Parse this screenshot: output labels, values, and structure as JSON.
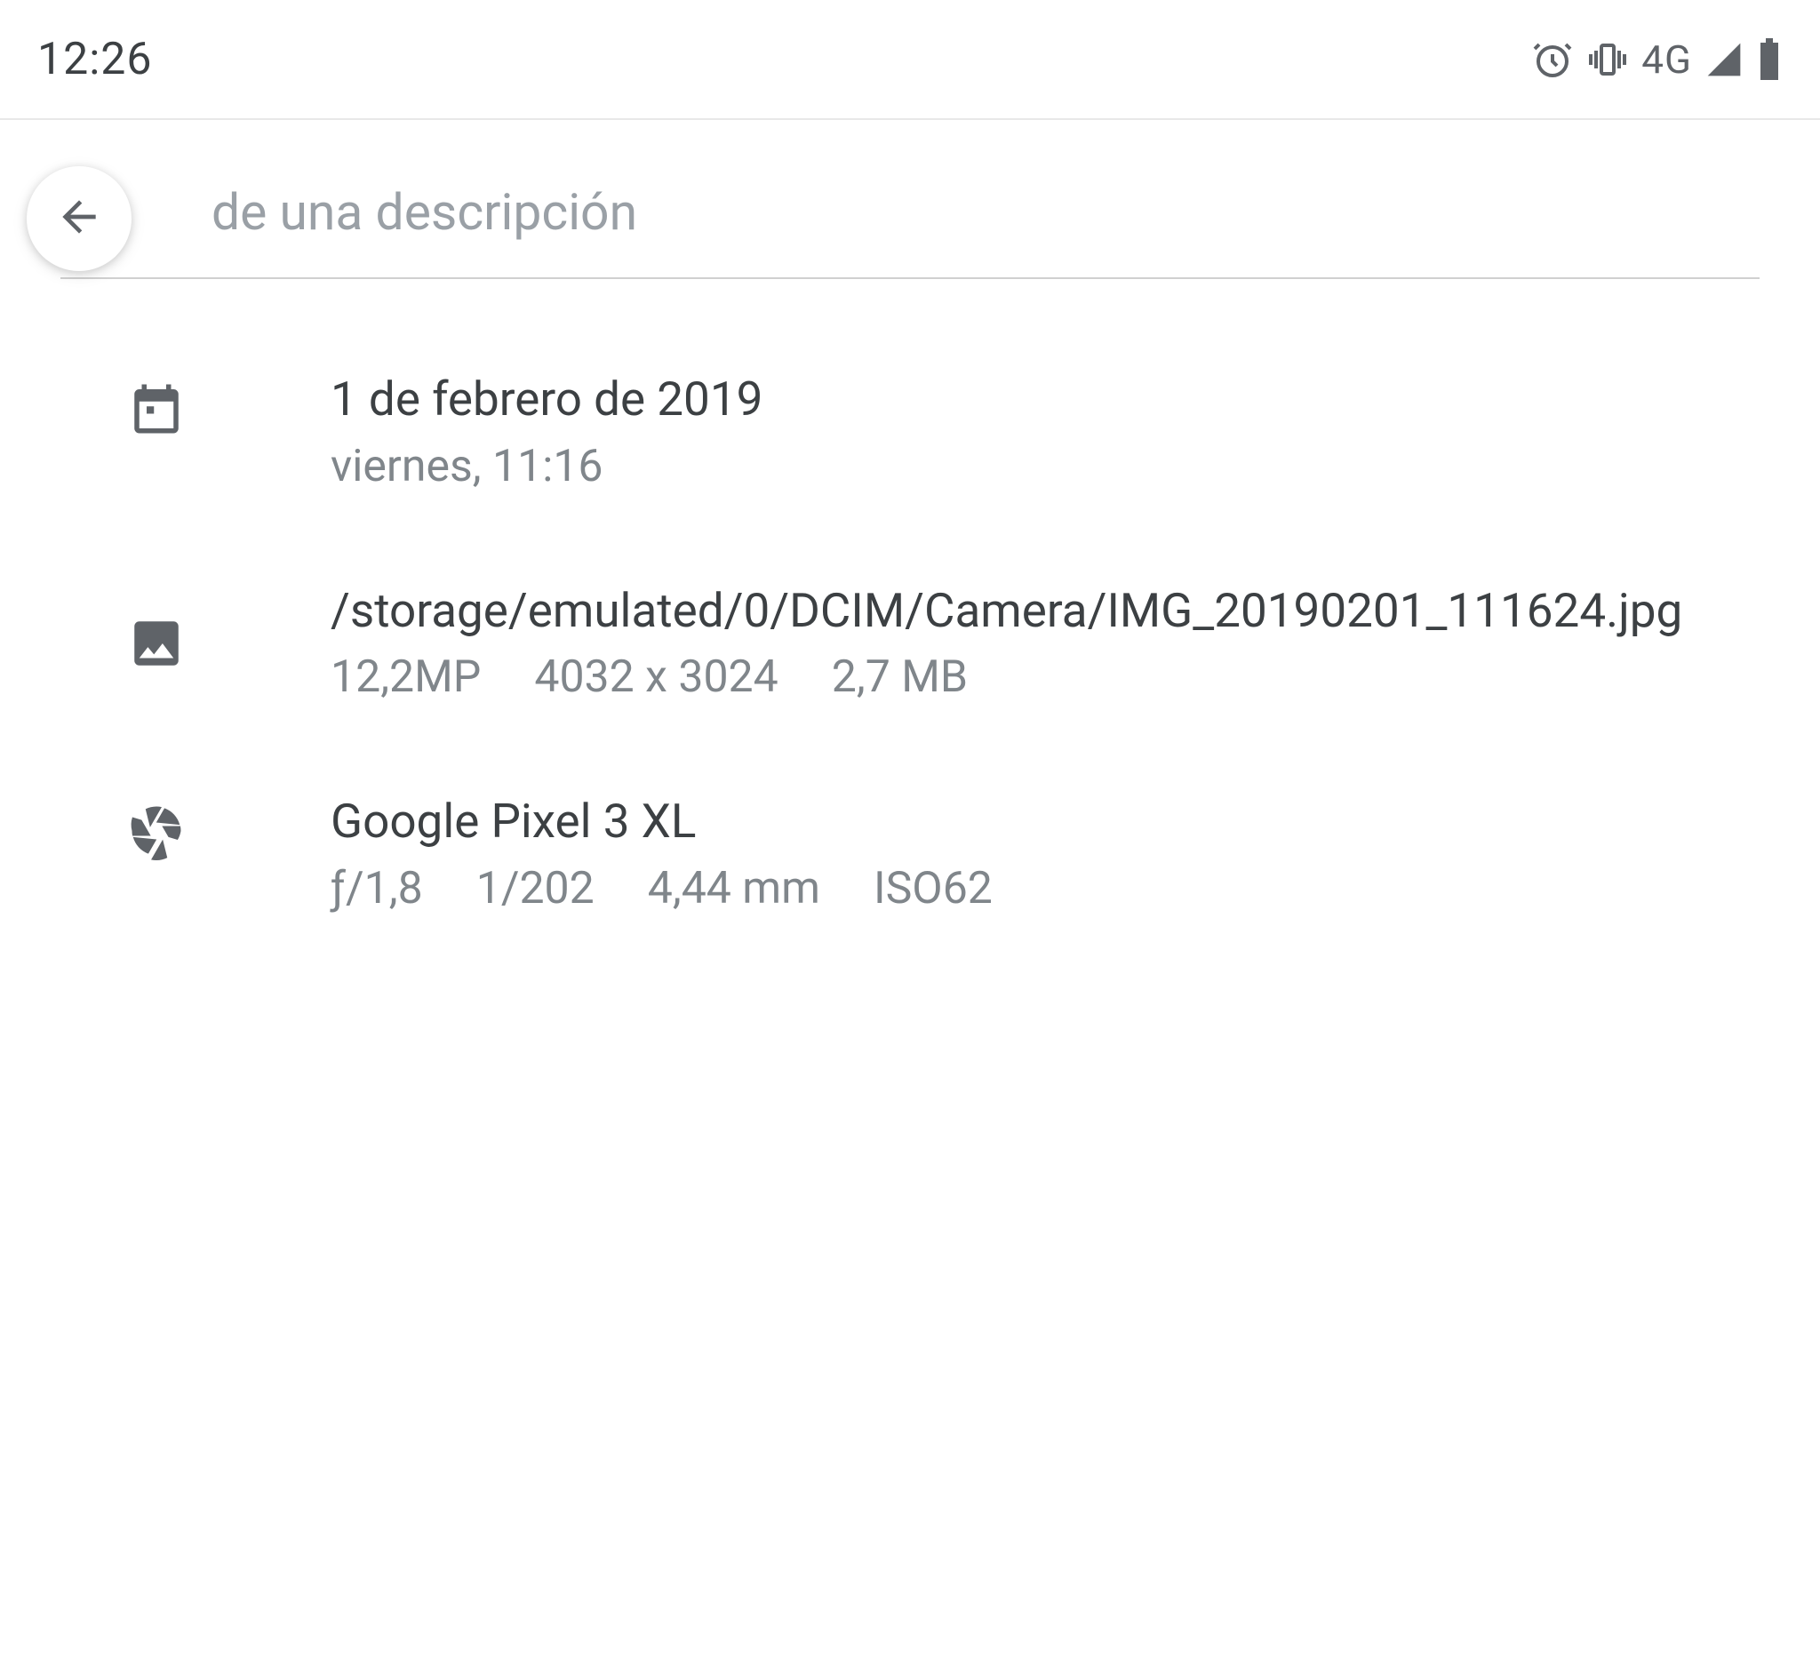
{
  "status": {
    "time": "12:26",
    "network": "4G"
  },
  "header": {
    "description_placeholder": "de una descripción"
  },
  "date": {
    "primary": "1 de febrero de 2019",
    "secondary": "viernes, 11:16"
  },
  "file": {
    "path": "/storage/emulated/0/DCIM/Camera/IMG_20190201_111624.jpg",
    "megapixels": "12,2MP",
    "dimensions": "4032 x 3024",
    "size": "2,7 MB"
  },
  "camera": {
    "device": "Google Pixel 3 XL",
    "aperture": "ƒ/1,8",
    "shutter": "1/202",
    "focal": "4,44 mm",
    "iso": "ISO62"
  }
}
